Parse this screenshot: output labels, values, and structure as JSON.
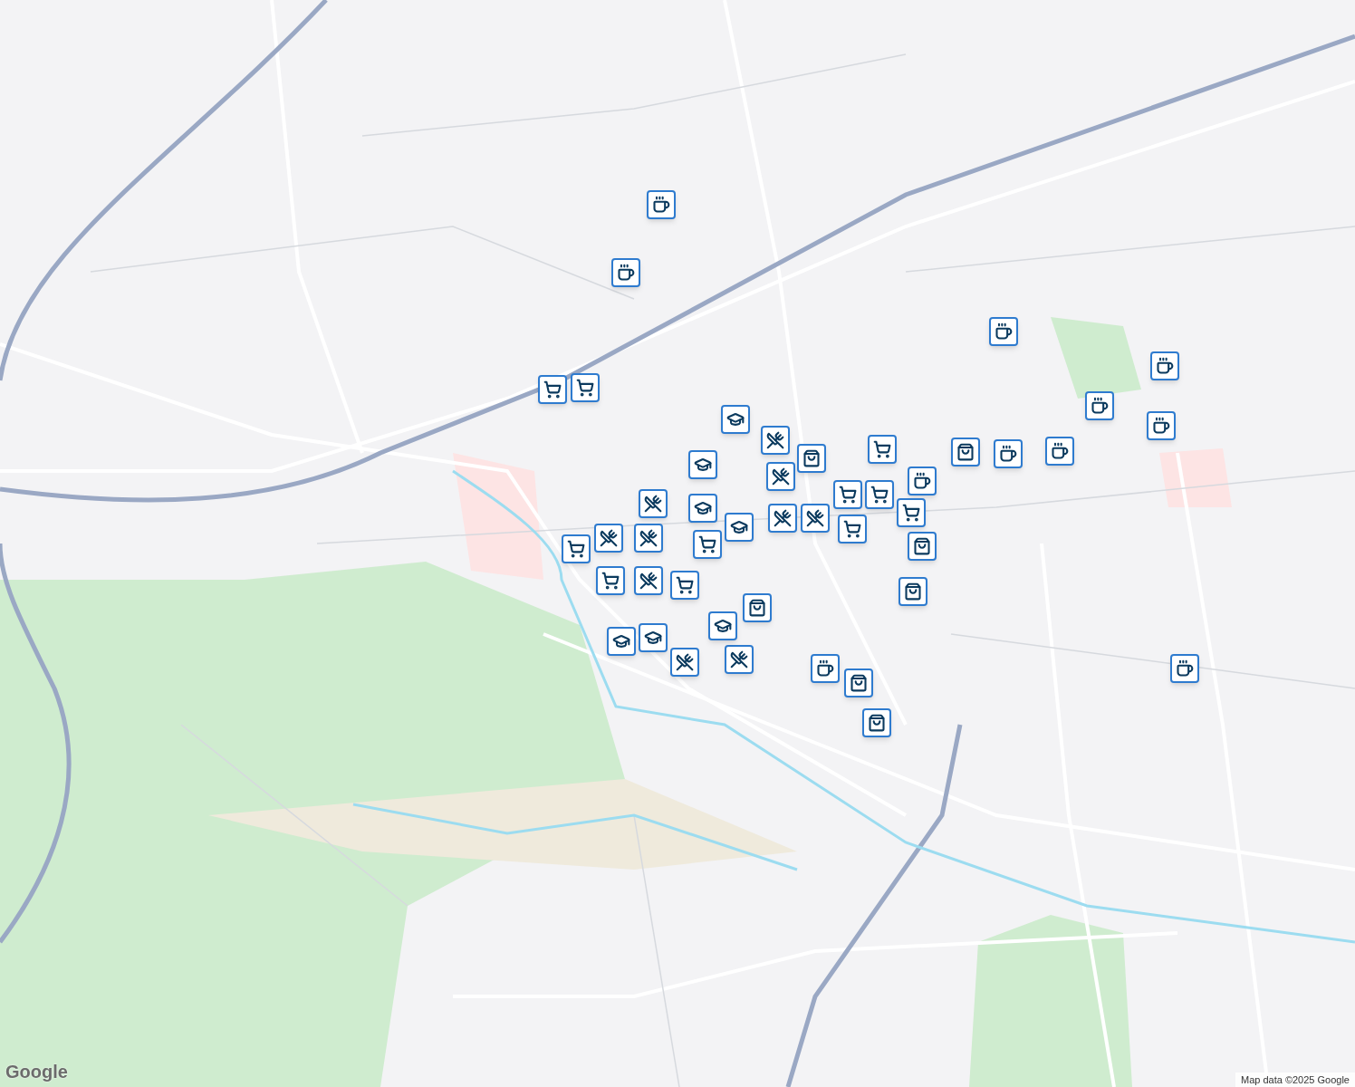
{
  "map": {
    "markers": [
      {
        "kind": "cafe"
      },
      {
        "kind": "cafe"
      },
      {
        "kind": "cafe"
      },
      {
        "kind": "cafe"
      },
      {
        "kind": "cafe"
      },
      {
        "kind": "cafe"
      },
      {
        "kind": "cafe"
      },
      {
        "kind": "cafe"
      },
      {
        "kind": "cafe"
      },
      {
        "kind": "cafe"
      },
      {
        "kind": "cafe"
      },
      {
        "kind": "cart"
      },
      {
        "kind": "cart"
      },
      {
        "kind": "cart"
      },
      {
        "kind": "cart"
      },
      {
        "kind": "cart"
      },
      {
        "kind": "cart"
      },
      {
        "kind": "cart"
      },
      {
        "kind": "cart"
      },
      {
        "kind": "cart"
      },
      {
        "kind": "cart"
      },
      {
        "kind": "cart"
      },
      {
        "kind": "food"
      },
      {
        "kind": "food"
      },
      {
        "kind": "food"
      },
      {
        "kind": "food"
      },
      {
        "kind": "food"
      },
      {
        "kind": "food"
      },
      {
        "kind": "food"
      },
      {
        "kind": "food"
      },
      {
        "kind": "food"
      },
      {
        "kind": "food"
      },
      {
        "kind": "school"
      },
      {
        "kind": "school"
      },
      {
        "kind": "school"
      },
      {
        "kind": "school"
      },
      {
        "kind": "school"
      },
      {
        "kind": "school"
      },
      {
        "kind": "school"
      },
      {
        "kind": "bag"
      },
      {
        "kind": "bag"
      },
      {
        "kind": "bag"
      },
      {
        "kind": "bag"
      },
      {
        "kind": "bag"
      },
      {
        "kind": "bag"
      },
      {
        "kind": "bag"
      }
    ]
  },
  "logo": "Google",
  "attribution": "Map data ©2025 Google"
}
